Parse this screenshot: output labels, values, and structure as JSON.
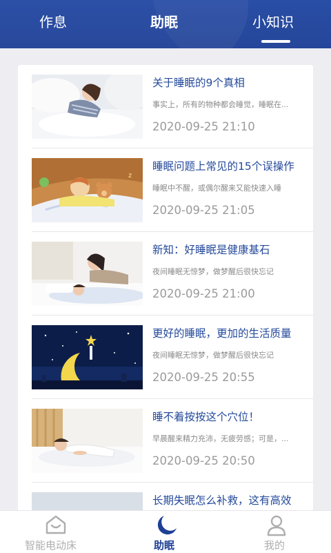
{
  "header": {
    "tabs": [
      {
        "label": "作息"
      },
      {
        "label": "助眠"
      },
      {
        "label": "小知识"
      }
    ],
    "active_tab": "小知识",
    "bg_color": "#1d3f95"
  },
  "articles": [
    {
      "title": "关于睡眠的9个真相",
      "summary": "事实上，所有的物种都会睡觉，睡眠在...",
      "time": "2020-09-25 21:10",
      "image": "child-sleeping-photo"
    },
    {
      "title": "睡眠问题上常见的15个误操作",
      "summary": "睡眠中不醒，或偶尔醒来又能快速入睡",
      "time": "2020-09-25 21:05",
      "image": "cartoon-boy-teddy-bear-illustration"
    },
    {
      "title": "新知：好睡眠是健康基石",
      "summary": "夜间睡眠无惊梦，做梦醒后很快忘记",
      "time": "2020-09-25 21:00",
      "image": "mother-child-bed-photo"
    },
    {
      "title": "更好的睡眠，更加的生活质量",
      "summary": "夜间睡眠无惊梦，做梦醒后很快忘记",
      "time": "2020-09-25 20:55",
      "image": "crescent-moon-night-illustration"
    },
    {
      "title": "睡不着按按这个穴位！",
      "summary": "早晨醒来精力充沛，无疲劳感；可是，...",
      "time": "2020-09-25 20:50",
      "image": "woman-sleeping-photo"
    },
    {
      "title": "长期失眠怎么补救，这有高效",
      "summary": "",
      "time": "",
      "image": "bedroom-photo"
    }
  ],
  "bottom_nav": {
    "items": [
      {
        "label": "智能电动床",
        "icon": "smart-bed-house-icon"
      },
      {
        "label": "助眠",
        "icon": "crescent-moon-icon"
      },
      {
        "label": "我的",
        "icon": "user-profile-icon"
      }
    ],
    "active": "助眠",
    "active_color": "#1d3f95",
    "inactive_color": "#aeaeae"
  }
}
